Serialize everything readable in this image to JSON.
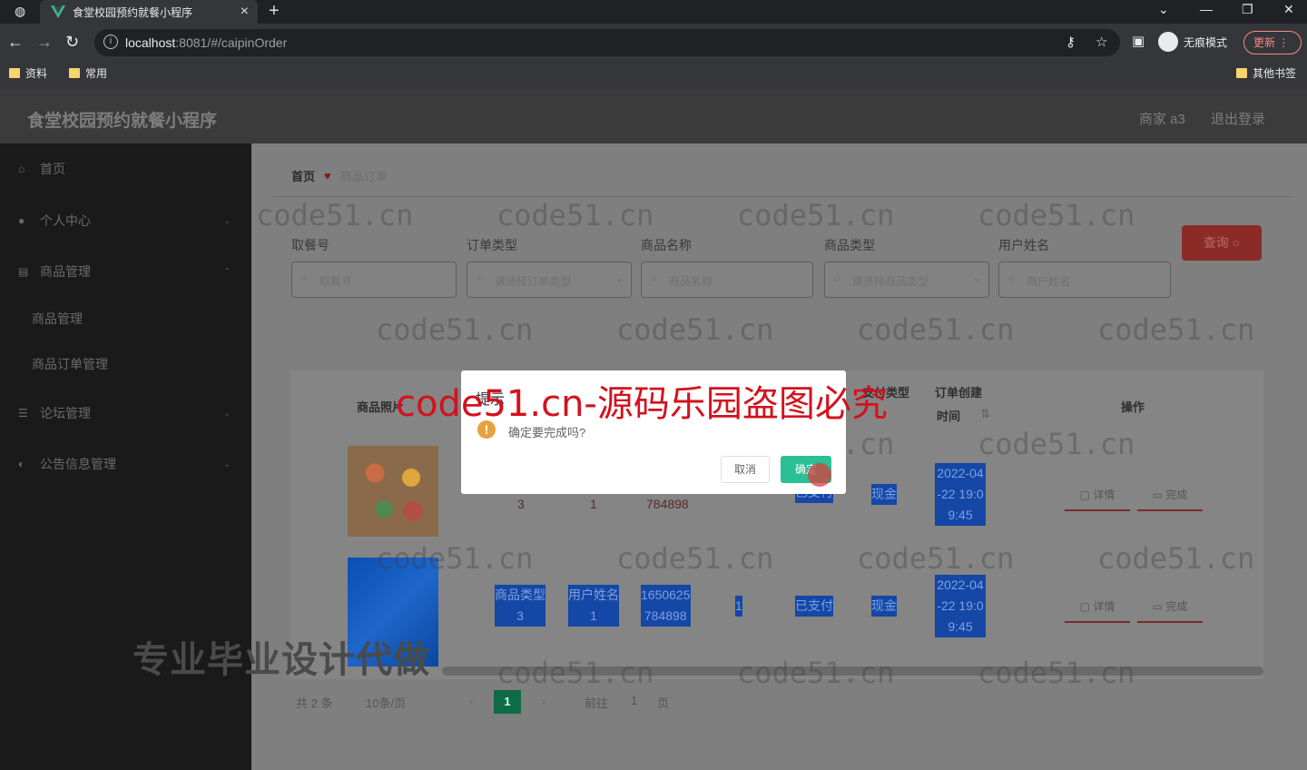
{
  "browser": {
    "tab_title": "食堂校园预约就餐小程序",
    "url_host": "localhost",
    "url_rest": ":8081/#/caipinOrder",
    "incognito": "无痕模式",
    "update": "更新",
    "bookmarks": [
      "资料",
      "常用"
    ],
    "other_bookmarks": "其他书签"
  },
  "header": {
    "title": "食堂校园预约就餐小程序",
    "user": "商家 a3",
    "logout": "退出登录"
  },
  "sidebar": {
    "items": [
      {
        "label": "首页",
        "icon": "home-icon"
      },
      {
        "label": "个人中心",
        "icon": "user-icon"
      },
      {
        "label": "商品管理",
        "icon": "goods-icon"
      },
      {
        "label": "商品管理"
      },
      {
        "label": "商品订单管理"
      },
      {
        "label": "论坛管理",
        "icon": "list-icon"
      },
      {
        "label": "公告信息管理",
        "icon": "notice-icon"
      }
    ]
  },
  "breadcrumb": {
    "home": "首页",
    "current": "商品订单"
  },
  "filters": {
    "labels": [
      "取餐号",
      "订单类型",
      "商品名称",
      "商品类型",
      "用户姓名"
    ],
    "placeholders": [
      "取餐号",
      "请选择订单类型",
      "商品名称",
      "请选择商品类型",
      "用户姓名"
    ],
    "search": "查询"
  },
  "table": {
    "headers": {
      "photo": "商品照片",
      "pay_type": "支付类型",
      "created": "订单创建",
      "created2": "时间",
      "ops": "操作"
    },
    "rows": [
      {
        "goods_type": "3",
        "user": "1",
        "order_no": "784898",
        "status": "已支付",
        "pay": "现金",
        "time": [
          "2022-04",
          "-22 19:0",
          "9:45"
        ]
      },
      {
        "goods_type_l": "商品类型",
        "goods_type": "3",
        "user_l": "用户姓名",
        "user": "1",
        "order_no_1": "1650625",
        "order_no": "784898",
        "qty": "1",
        "status": "已支付",
        "pay": "现金",
        "time": [
          "2022-04",
          "-22 19:0",
          "9:45"
        ]
      }
    ],
    "op_detail": "详情",
    "op_done": "完成"
  },
  "pagination": {
    "total": "共 2 条",
    "size": "10条/页",
    "current": "1",
    "goto": "前往",
    "page": "1",
    "unit": "页"
  },
  "dialog": {
    "title": "提示",
    "message": "确定要完成吗?",
    "cancel": "取消",
    "ok": "确定"
  },
  "watermarks": {
    "site": "code51.cn",
    "red": "code51.cn-源码乐园盗图必究",
    "promo": "专业毕业设计代做"
  }
}
